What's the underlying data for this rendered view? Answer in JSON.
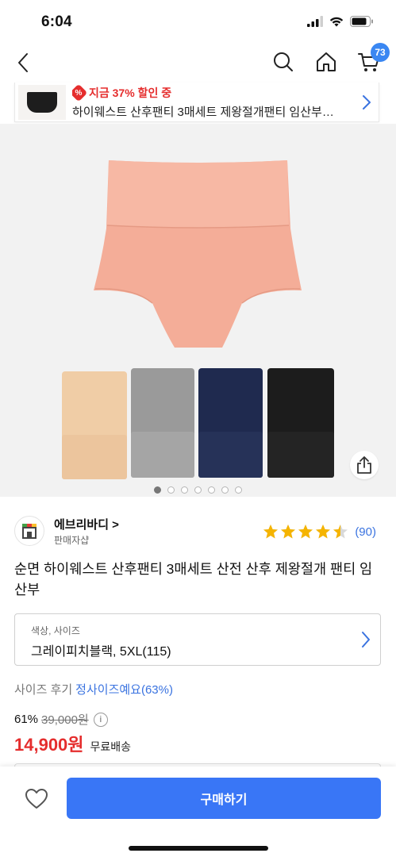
{
  "status_bar": {
    "time": "6:04"
  },
  "nav": {
    "cart_count": "73"
  },
  "promo": {
    "discount_text": "지금 37% 할인 중",
    "badge_symbol": "%",
    "product_name": "하이웨스트 산후팬티 3매세트 제왕절개팬티 임산부…"
  },
  "gallery": {
    "total_images": 7,
    "active_index": 0
  },
  "seller": {
    "name": "에브리바디 >",
    "subtitle": "판매자샵"
  },
  "rating": {
    "stars": 4.5,
    "count": "(90)"
  },
  "product": {
    "title": "순면 하이웨스트 산후팬티 3매세트 산전 산후 제왕절개 팬티 임산부"
  },
  "option": {
    "label": "색상, 사이즈",
    "value": "그레이피치블랙, 5XL(115)"
  },
  "size_review": {
    "label": "사이즈 후기",
    "value": "정사이즈예요(63%)"
  },
  "price": {
    "discount_rate": "61%",
    "original": "39,000원",
    "sale": "14,900원",
    "shipping": "무료배송"
  },
  "bottom": {
    "buy_label": "구매하기"
  },
  "colors": {
    "accent_blue": "#3976f6",
    "sale_red": "#e52d2d",
    "star_yellow": "#f5b400",
    "product_peach": "#f4ad98",
    "product_beige": "#f0cda6",
    "product_gray": "#9a9a9a",
    "product_navy": "#1f2a4f",
    "product_black": "#1c1c1c"
  }
}
